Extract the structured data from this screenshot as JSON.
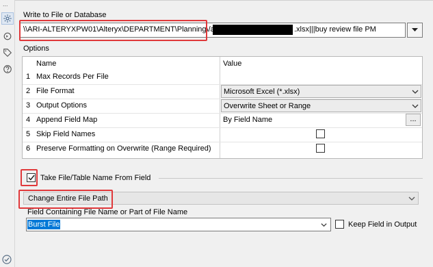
{
  "rail": {
    "dots": "...",
    "icons": [
      "gear-icon",
      "refresh-icon",
      "tag-icon",
      "help-icon"
    ]
  },
  "output": {
    "section_title": "Write to File or Database",
    "path_prefix": "\\\\ARI-ALTERYXPW01\\Alteryx\\DEPARTMENT\\Planning\\/a",
    "path_suffix": ".xlsx|||buy review file PM"
  },
  "options": {
    "section_title": "Options",
    "headers": {
      "name": "Name",
      "value": "Value"
    },
    "rows": [
      {
        "num": "1",
        "name": "Max Records Per File",
        "value": ""
      },
      {
        "num": "2",
        "name": "File Format",
        "value": "Microsoft Excel (*.xlsx)"
      },
      {
        "num": "3",
        "name": "Output Options",
        "value": "Overwrite Sheet or Range"
      },
      {
        "num": "4",
        "name": "Append Field Map",
        "value": "By Field Name",
        "button": "..."
      },
      {
        "num": "5",
        "name": "Skip Field Names",
        "value": ""
      },
      {
        "num": "6",
        "name": "Preserve Formatting on Overwrite (Range Required)",
        "value": ""
      }
    ]
  },
  "take_name": {
    "label": "Take File/Table Name From Field",
    "checked": true
  },
  "change_mode": {
    "selected": "Change Entire File Path"
  },
  "field": {
    "label": "Field Containing File Name or Part of File Name",
    "selected": "Burst File",
    "keep_label": "Keep Field in Output"
  },
  "colors": {
    "annotation_red": "#e0383a",
    "selection_blue": "#0078d7"
  }
}
